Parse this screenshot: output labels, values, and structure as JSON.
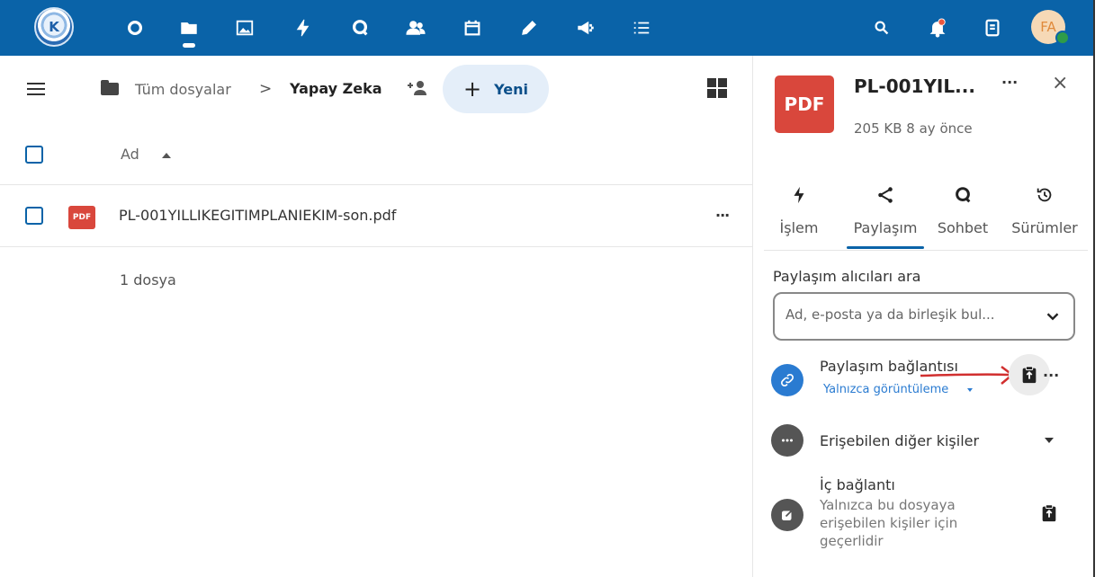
{
  "topbar": {
    "logo_text": "K",
    "apps": [
      "dashboard-icon",
      "files-icon",
      "photos-icon",
      "activity-icon",
      "talk-icon",
      "contacts-icon",
      "calendar-icon",
      "notes-icon",
      "announcements-icon",
      "tasks-icon"
    ],
    "avatar_initials": "FA",
    "colors": {
      "bar": "#0a63a8",
      "avatar_bg": "#f6d9b6",
      "status": "#2e9c49"
    }
  },
  "breadcrumb": {
    "root": "Tüm dosyalar",
    "separator": ">",
    "current": "Yapay Zeka"
  },
  "new_button": {
    "plus": "+",
    "label": "Yeni"
  },
  "file_list": {
    "column_name": "Ad",
    "files": [
      {
        "icon": "PDF",
        "name": "PL-001YILLIKEGITIMPLANIEKIM-son.pdf",
        "actions": "···"
      }
    ],
    "summary": "1 dosya"
  },
  "sidebar": {
    "file_icon": "PDF",
    "title": "PL-001YIL...",
    "meta": "205 KB 8 ay önce",
    "more": "···",
    "close": "×",
    "tabs": [
      {
        "label": "İşlem",
        "icon": "activity-icon"
      },
      {
        "label": "Paylaşım",
        "icon": "share-icon"
      },
      {
        "label": "Sohbet",
        "icon": "talk-icon"
      },
      {
        "label": "Sürümler",
        "icon": "history-icon"
      }
    ],
    "search_label": "Paylaşım alıcıları ara",
    "search_placeholder": "Ad, e-posta ya da birleşik bul...",
    "share_link": {
      "title": "Paylaşım bağlantısı",
      "permission": "Yalnızca görüntüleme",
      "more": "···"
    },
    "others": {
      "label": "Erişebilen diğer kişiler"
    },
    "internal_link": {
      "title": "İç bağlantı",
      "description": "Yalnızca bu dosyaya erişebilen kişiler için geçerlidir"
    },
    "colors": {
      "accent": "#0a63a8",
      "pdf": "#d9473c",
      "link": "#2a7bd1",
      "arrow": "#d12f2f"
    }
  }
}
